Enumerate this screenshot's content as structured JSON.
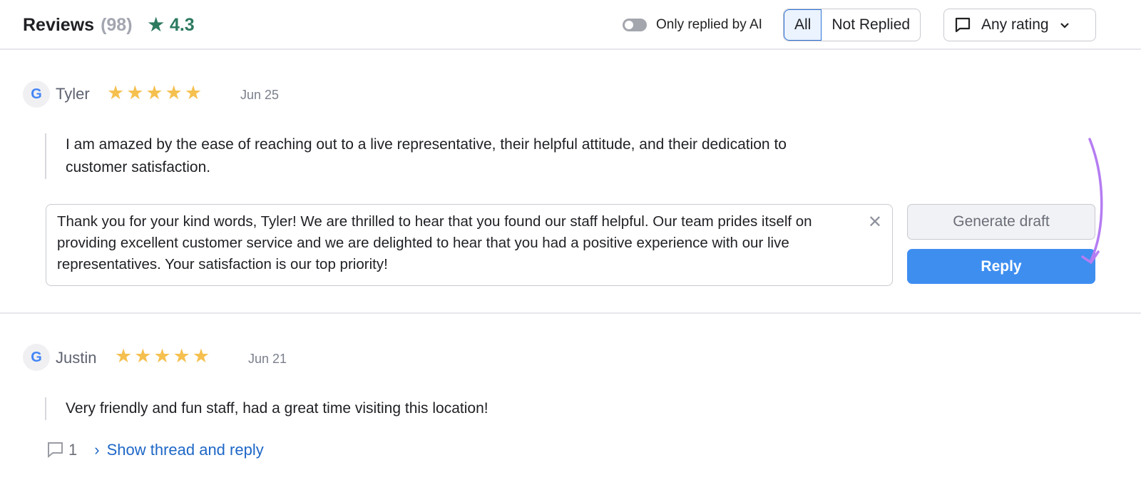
{
  "header": {
    "title": "Reviews",
    "count": "(98)",
    "rating": "4.3",
    "toggle_label": "Only replied by AI",
    "toggle_on": false,
    "filters": [
      "All",
      "Not Replied"
    ],
    "active_filter": "All",
    "rating_dropdown": "Any rating"
  },
  "reviews": [
    {
      "author": "Tyler",
      "source": "google",
      "stars": "★★★★★",
      "rating": 5,
      "date": "Jun 25",
      "text": "I am amazed by the ease of reaching out to a live representative, their helpful attitude, and their dedication to customer satisfaction.",
      "reply_draft": "Thank you for your kind words, Tyler! We are thrilled to hear that you found our staff helpful. Our team prides itself on providing excellent customer service and we are delighted to hear that you had a positive experience with our live representatives. Your satisfaction is our top priority!",
      "generate_label": "Generate draft",
      "reply_label": "Reply"
    },
    {
      "author": "Justin",
      "source": "google",
      "stars": "★★★★★",
      "rating": 5,
      "date": "Jun 21",
      "text": "Very friendly and fun staff, had a great time visiting this location!",
      "comment_count": "1",
      "thread_link": "Show thread and reply"
    }
  ],
  "colors": {
    "accent": "#3e8ef0",
    "star": "#f5c04f",
    "rating": "#2d7a5f",
    "link": "#1e67c7",
    "arrow": "#b57cf2"
  }
}
